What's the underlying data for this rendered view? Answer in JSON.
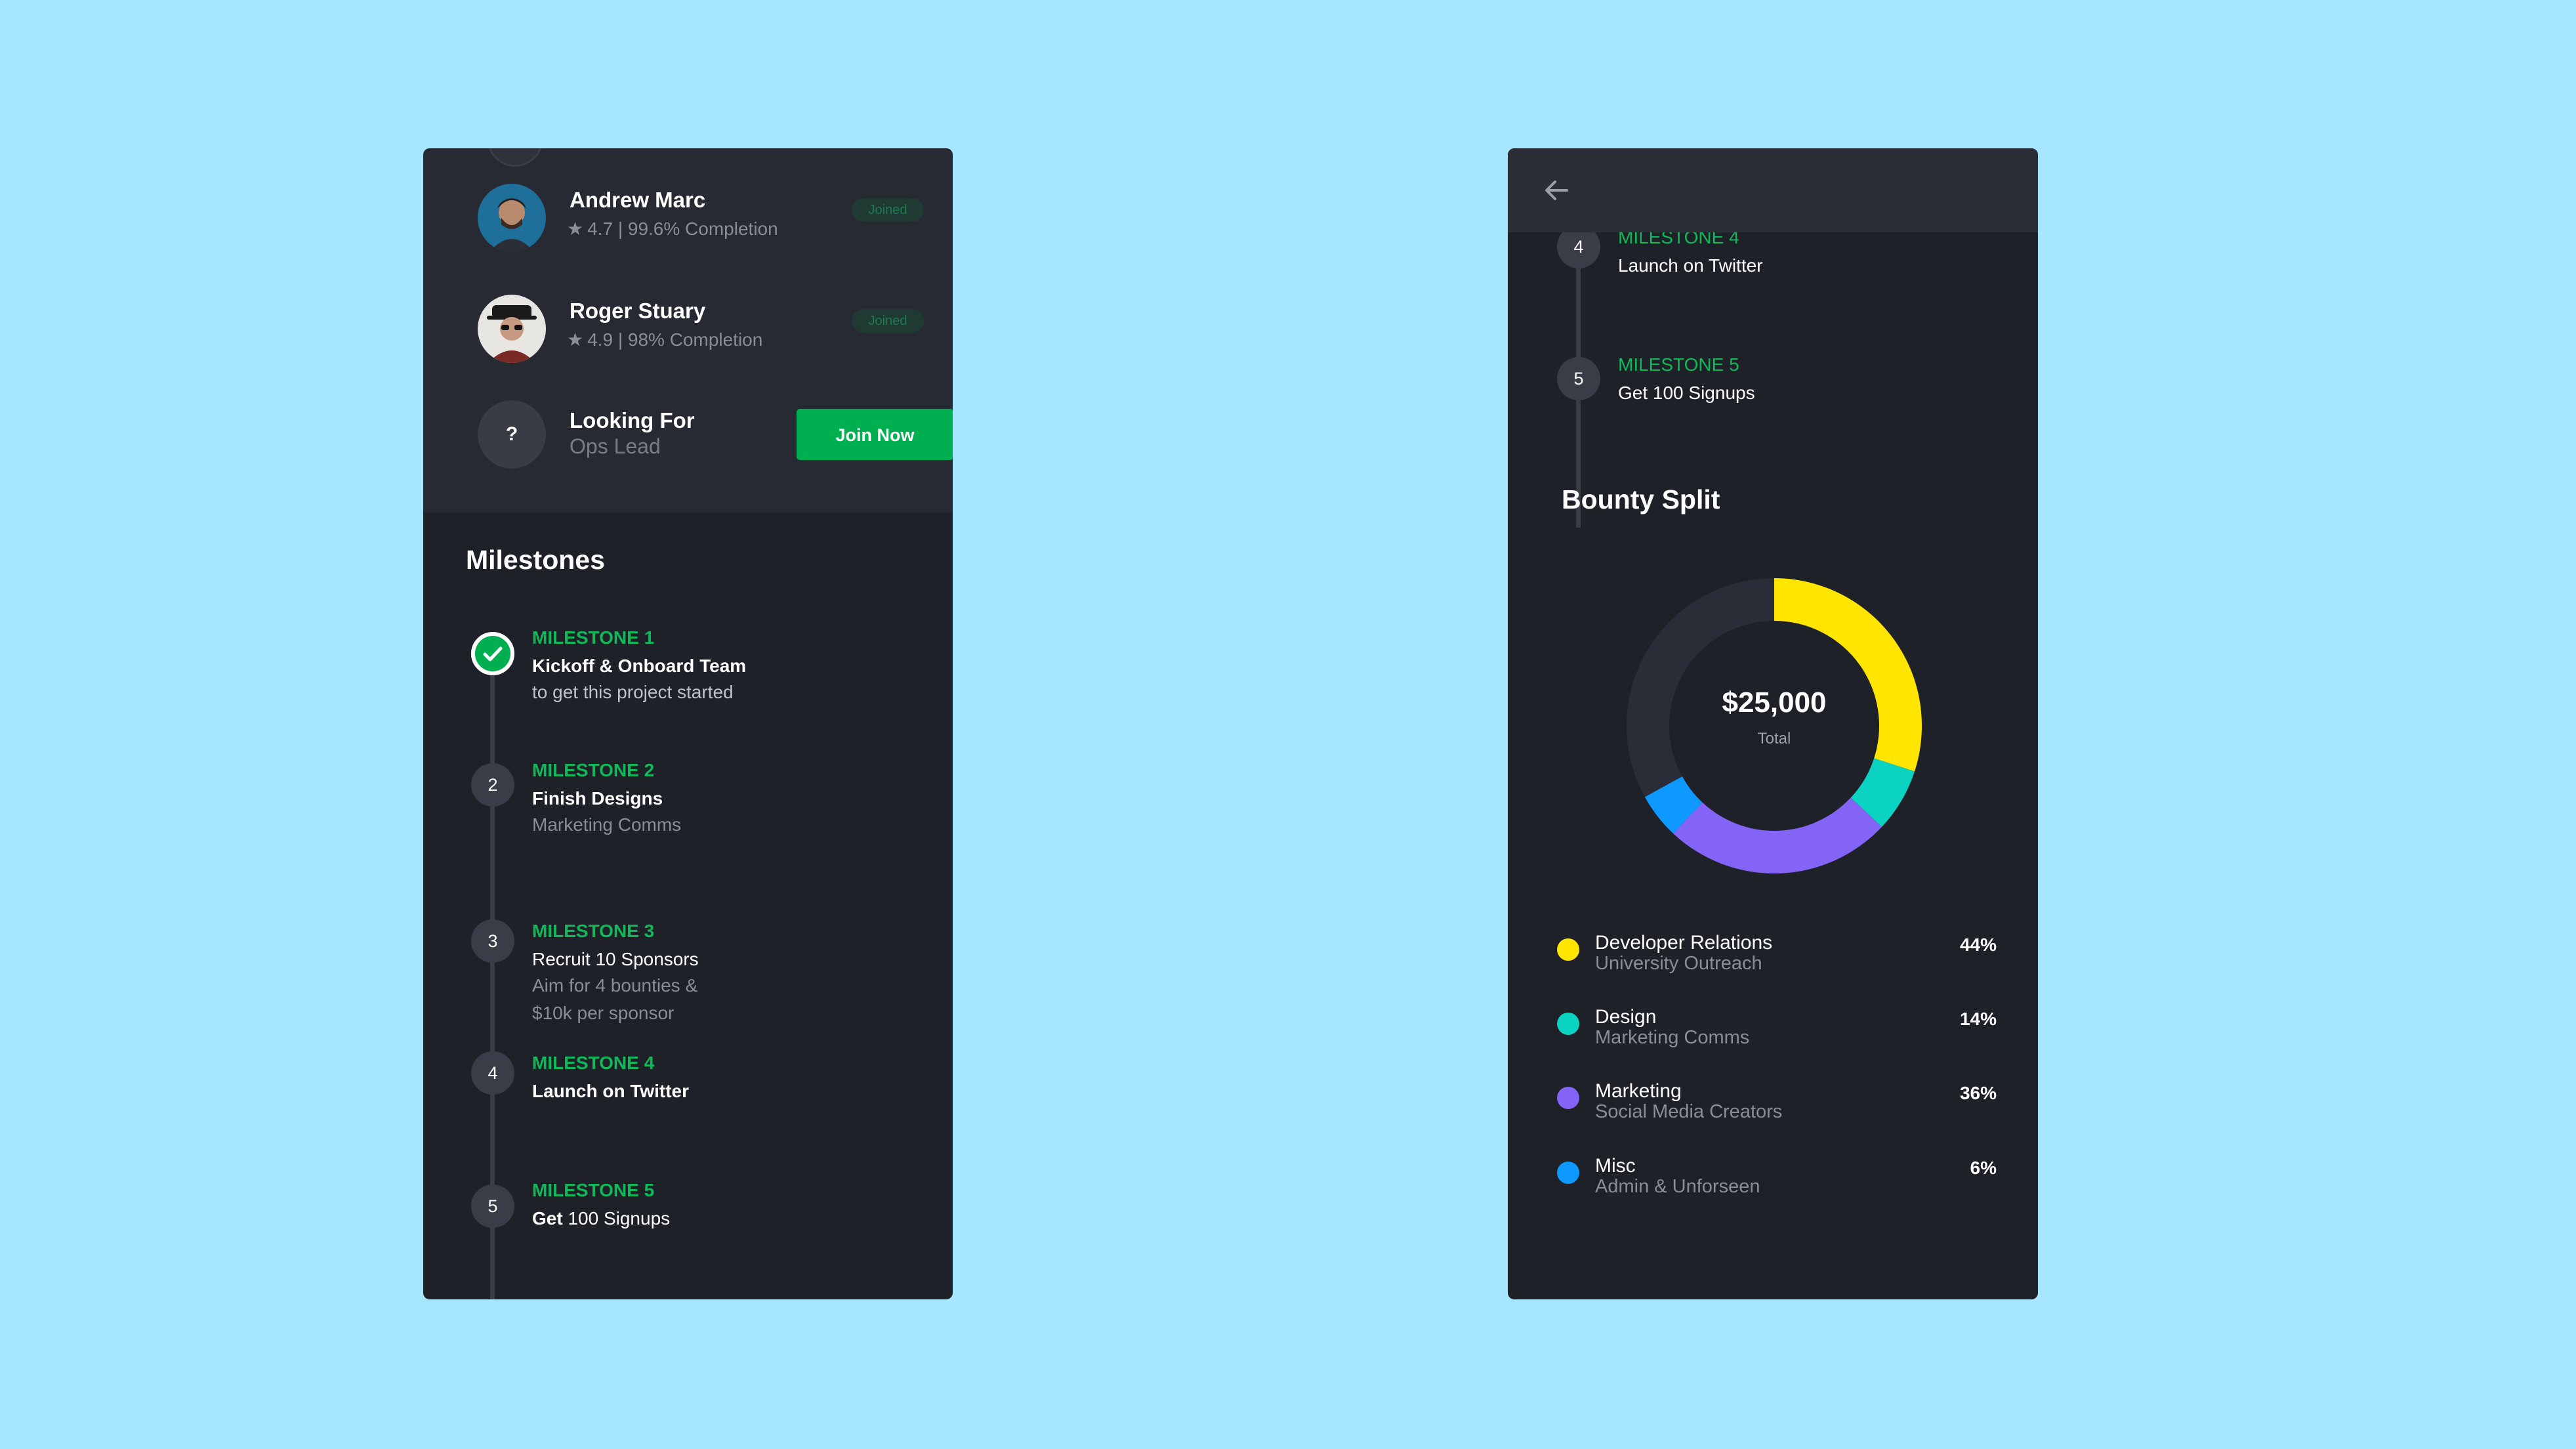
{
  "team": {
    "members": [
      {
        "name": "Andrew Marc",
        "rating": "4.7",
        "stats": "| 99.6% Completion",
        "badge": "Joined"
      },
      {
        "name": "Roger Stuary",
        "rating": "4.9",
        "stats": "| 98% Completion",
        "badge": "Joined"
      }
    ],
    "looking": {
      "avatar": "?",
      "title": "Looking For",
      "role": "Ops Lead",
      "button": "Join Now"
    }
  },
  "milestones": {
    "title": "Milestones",
    "items": [
      {
        "num": "",
        "label": "MILESTONE 1",
        "title": "Kickoff & Onboard Team",
        "desc": "to get this project started"
      },
      {
        "num": "2",
        "label": "MILESTONE 2",
        "title": "Finish Designs",
        "desc": "Marketing Comms"
      },
      {
        "num": "3",
        "label": "MILESTONE 3",
        "title": "Recruit 10 Sponsors",
        "desc_line1": "Aim for 4 bounties &",
        "desc_line2": "$10k per sponsor"
      },
      {
        "num": "4",
        "label": "MILESTONE 4",
        "title": "Launch on Twitter"
      },
      {
        "num": "5",
        "label": "MILESTONE 5",
        "title_bold": "Get",
        "title_rest": " 100 Signups"
      }
    ]
  },
  "right": {
    "milestones": [
      {
        "num": "4",
        "label": "MILESTONE 4",
        "title": "Launch on Twitter"
      },
      {
        "num": "5",
        "label": "MILESTONE 5",
        "title": "Get 100 Signups"
      }
    ],
    "bounty_title": "Bounty Split",
    "total": "$25,000",
    "total_label": "Total"
  },
  "bounty_split": [
    {
      "name": "Developer Relations",
      "sub": "University Outreach",
      "pct_label": "44%",
      "value": 44,
      "color": "#ffe500"
    },
    {
      "name": "Design",
      "sub": "Marketing Comms",
      "pct_label": "14%",
      "value": 14,
      "color": "#0ad3c1"
    },
    {
      "name": "Marketing",
      "sub": "Social Media Creators",
      "pct_label": "36%",
      "value": 36,
      "color": "#8464f7"
    },
    {
      "name": "Misc",
      "sub": "Admin & Unforseen",
      "pct_label": "6%",
      "value": 6,
      "color": "#0d99ff"
    }
  ],
  "colors": {
    "background": "#a6e6fe",
    "card": "#1f2128",
    "accent": "#00b050",
    "unallocated": "#2a2d37"
  }
}
